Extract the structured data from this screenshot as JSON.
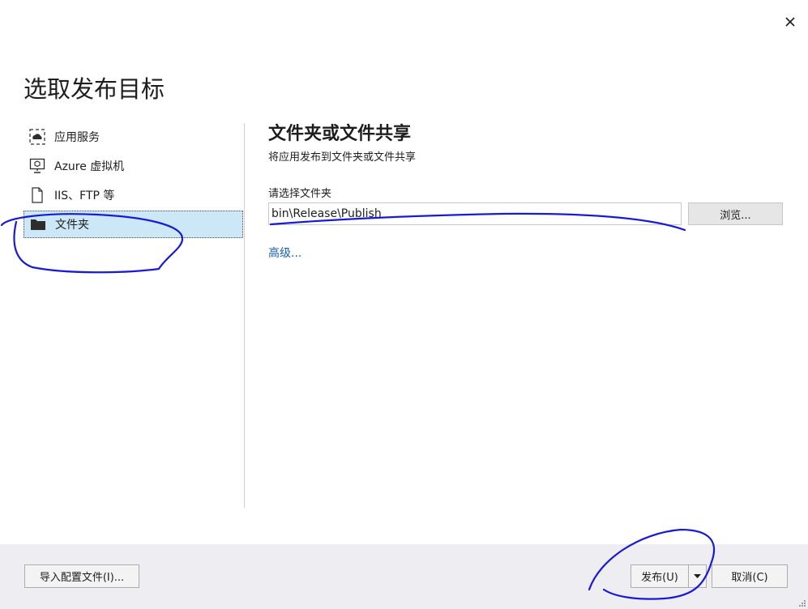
{
  "dialog": {
    "title": "选取发布目标",
    "close_icon": "close-icon"
  },
  "sidebar": {
    "items": [
      {
        "label": "应用服务",
        "icon": "app-service-icon"
      },
      {
        "label": "Azure 虚拟机",
        "icon": "virtual-machine-icon"
      },
      {
        "label": "IIS、FTP 等",
        "icon": "file-icon"
      },
      {
        "label": "文件夹",
        "icon": "folder-icon",
        "selected": true
      }
    ]
  },
  "main": {
    "title": "文件夹或文件共享",
    "subtitle": "将应用发布到文件夹或文件共享",
    "folder_label": "请选择文件夹",
    "folder_value": "bin\\Release\\Publish",
    "browse_label": "浏览...",
    "advanced_label": "高级..."
  },
  "footer": {
    "import_label": "导入配置文件(I)...",
    "publish_label": "发布(U)",
    "cancel_label": "取消(C)"
  },
  "colors": {
    "selection_bg": "#cce8f7",
    "link": "#1a5fb4",
    "footer_bg": "#eeeef2",
    "annotation_ink": "#1a1ad4"
  }
}
